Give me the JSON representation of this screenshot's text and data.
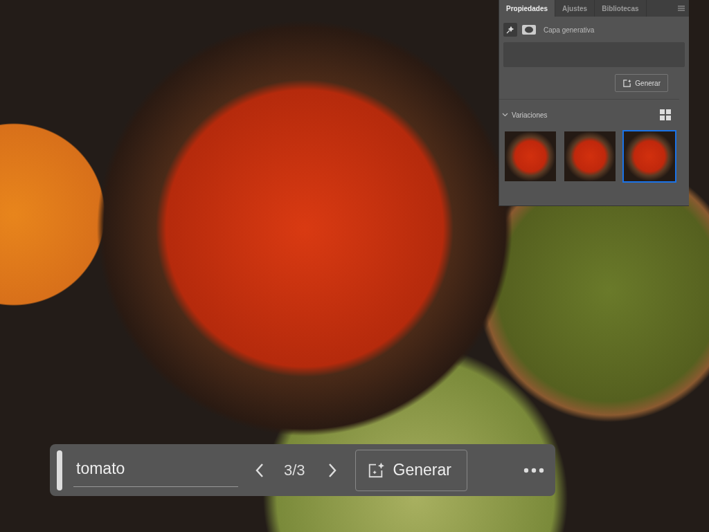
{
  "panel": {
    "tabs": [
      {
        "label": "Propiedades",
        "selected": true
      },
      {
        "label": "Ajustes",
        "selected": false
      },
      {
        "label": "Bibliotecas",
        "selected": false
      }
    ],
    "layer_type": "Capa generativa",
    "generate_button": "Generar",
    "variations": {
      "title": "Variaciones",
      "expanded": true,
      "items": [
        {
          "selected": false
        },
        {
          "selected": false
        },
        {
          "selected": true
        }
      ]
    }
  },
  "taskbar": {
    "prompt": "tomato",
    "counter": "3/3",
    "generate_button": "Generar"
  }
}
